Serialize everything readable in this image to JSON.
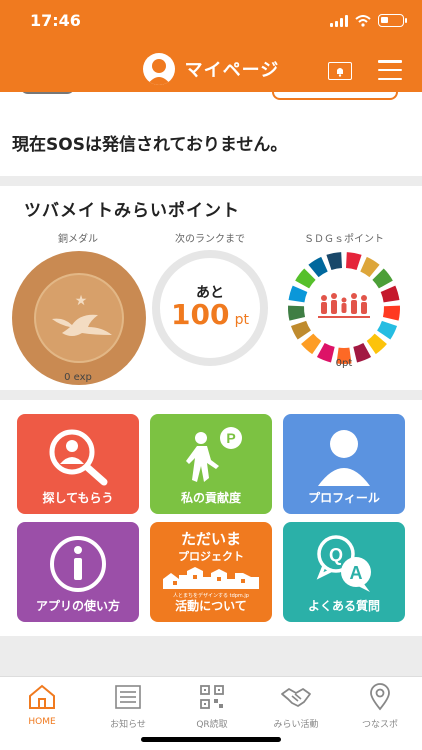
{
  "status": {
    "time": "17:46"
  },
  "nav": {
    "title": "マイページ"
  },
  "sos": {
    "message": "現在SOSは発信されておりません。"
  },
  "points": {
    "title": "ツバメイトみらいポイント",
    "medal": {
      "label": "銅メダル",
      "value": "0 exp"
    },
    "rank": {
      "label": "次のランクまで",
      "prefix": "あと",
      "value": "100",
      "unit": "pt"
    },
    "sdgs": {
      "label": "ＳＤＧｓポイント",
      "value": "0pt"
    }
  },
  "tiles": [
    {
      "label": "探してもらう",
      "color": "#ee5a45"
    },
    {
      "label": "私の貢献度",
      "color": "#7cc242"
    },
    {
      "label": "プロフィール",
      "color": "#5b93e0"
    },
    {
      "label": "アプリの使い方",
      "color": "#9b4fa8"
    },
    {
      "label": "活動について",
      "color": "#f07a1f",
      "banner_title": "ただいま",
      "banner_sub": "プロジェクト",
      "banner_caption": "人とまちをデザインする tdpm.jp"
    },
    {
      "label": "よくある質問",
      "color": "#2bb0a8"
    }
  ],
  "tabs": [
    {
      "label": "HOME"
    },
    {
      "label": "お知らせ"
    },
    {
      "label": "QR読取"
    },
    {
      "label": "みらい活動"
    },
    {
      "label": "つなスポ"
    }
  ],
  "colors": {
    "brand": "#f07a1f",
    "bronze": "#c98a52"
  }
}
